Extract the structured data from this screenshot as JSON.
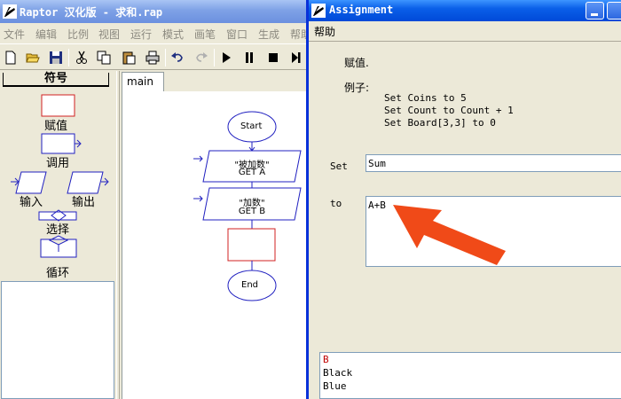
{
  "main_window": {
    "title": "Raptor 汉化版 - 求和.rap",
    "menu": [
      "文件",
      "编辑",
      "比例",
      "视图",
      "运行",
      "模式",
      "画笔",
      "窗口",
      "生成",
      "帮助"
    ],
    "toolbar_icons": [
      "new-icon",
      "open-icon",
      "save-icon",
      "cut-icon",
      "copy-icon",
      "paste-icon",
      "print-icon",
      "undo-icon",
      "redo-icon",
      "run-icon",
      "pause-icon",
      "stop-icon",
      "step-icon"
    ]
  },
  "palette": {
    "heading": "符号",
    "items": {
      "assign": "赋值",
      "call": "调用",
      "input": "输入",
      "output": "输出",
      "select": "选择",
      "loop": "循环"
    }
  },
  "flowchart": {
    "tab": "main",
    "start": "Start",
    "input1_line1": "\"被加数\"",
    "input1_line2": "GET A",
    "input2_line1": "\"加数\"",
    "input2_line2": "GET B",
    "end": "End"
  },
  "dialog": {
    "title": "Assignment",
    "menu_help": "帮助",
    "description": "赋值.",
    "examples_heading": "例子:",
    "examples": [
      "Set Coins to 5",
      "Set Count to Count + 1",
      "Set Board[3,3] to 0"
    ],
    "set_label": "Set",
    "set_value": "Sum",
    "to_label": "to",
    "to_value": "A+B",
    "suggestions": [
      "B",
      "Black",
      "Blue"
    ]
  },
  "colors": {
    "title_active": "#0a5fe8",
    "title_inactive": "#7ea1e6",
    "flow_blue": "#2020c0",
    "flow_red": "#c02020",
    "arrow": "#f04a18",
    "suggestion_highlight": "#c00000"
  }
}
